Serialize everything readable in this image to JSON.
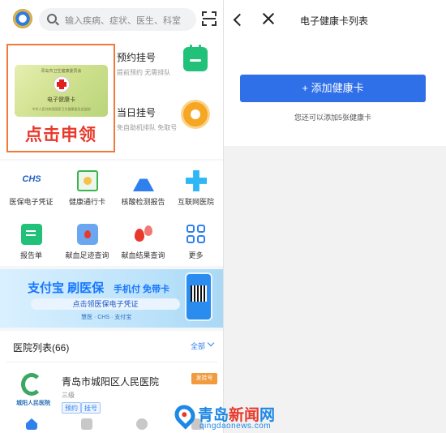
{
  "left": {
    "search": {
      "placeholder": "输入疾病、症状、医生、科室"
    },
    "health_card": {
      "card_org": "青岛市卫生健康委员会",
      "card_name": "电子健康卡",
      "card_sub": "中华人民共和国国家卫生健康委员会监制",
      "apply_text": "点击申领"
    },
    "services": [
      {
        "title": "预约挂号",
        "subtitle": "提前预约 无需排队"
      },
      {
        "title": "当日挂号",
        "subtitle": "免自助机排队 免取号"
      }
    ],
    "quick": [
      {
        "label": "医保电子凭证",
        "icon": "chs-icon",
        "icon_text": "CHS"
      },
      {
        "label": "健康通行卡",
        "icon": "pass-card-icon"
      },
      {
        "label": "核酸检测报告",
        "icon": "flask-icon"
      },
      {
        "label": "互联网医院",
        "icon": "medical-cross-icon"
      },
      {
        "label": "报告单",
        "icon": "report-icon"
      },
      {
        "label": "献血足迹查询",
        "icon": "blood-record-icon"
      },
      {
        "label": "献血结果查询",
        "icon": "blood-drops-icon"
      },
      {
        "label": "更多",
        "icon": "grid-more-icon"
      }
    ],
    "banner": {
      "title": "支付宝 刷医保",
      "slogan": "手机付 免带卡",
      "cta": "点击领医保电子凭证",
      "partners": "慧医 · CHS · 支付宝"
    },
    "hospital_list": {
      "title": "医院列表(66)",
      "all_label": "全部",
      "items": [
        {
          "name": "青岛市城阳区人民医院",
          "level": "三级",
          "tags": [
            "预约",
            "挂号"
          ],
          "badge": "发挂号",
          "logo_text": "城阳人民医院"
        }
      ]
    }
  },
  "right": {
    "title": "电子健康卡列表",
    "add_button": "+ 添加健康卡",
    "hint": "您还可以添加5张健康卡"
  },
  "watermark": {
    "brand_part1": "青岛",
    "brand_part2": "新闻",
    "brand_part3": "网",
    "domain": "qingdaonews.com"
  },
  "colors": {
    "accent": "#2f6fe8",
    "apply_red": "#e8392c",
    "highlight_border": "#ef7a3a",
    "green": "#22c17a"
  }
}
